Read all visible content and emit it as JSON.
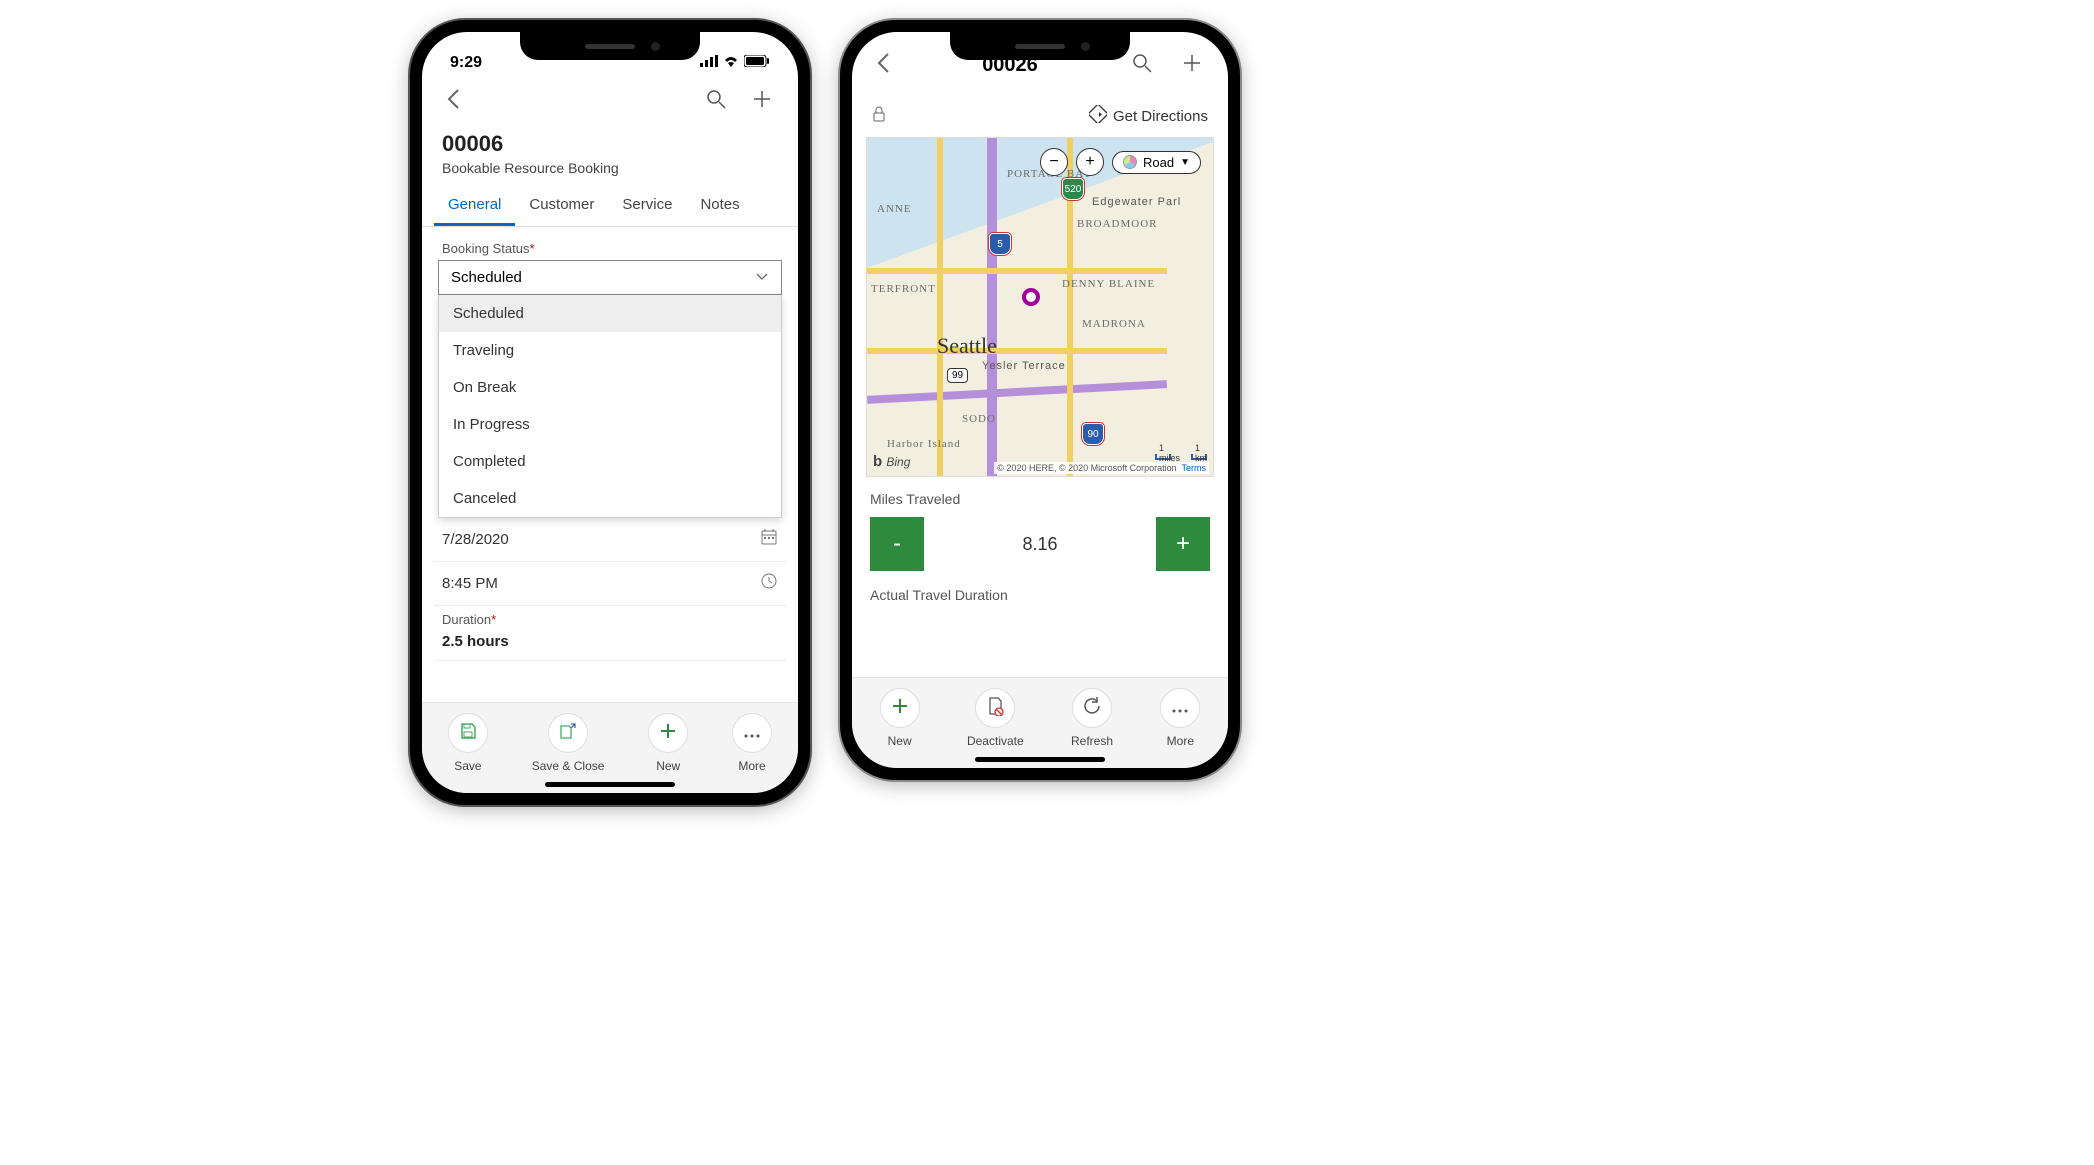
{
  "phone1": {
    "status_time": "9:29",
    "record_title": "00006",
    "record_subtitle": "Bookable Resource Booking",
    "tabs": [
      "General",
      "Customer",
      "Service",
      "Notes"
    ],
    "active_tab": "General",
    "booking_status_label": "Booking Status",
    "booking_status_value": "Scheduled",
    "status_options": [
      "Scheduled",
      "Traveling",
      "On Break",
      "In Progress",
      "Completed",
      "Canceled"
    ],
    "date_value": "7/28/2020",
    "time_value": "8:45 PM",
    "duration_label": "Duration",
    "duration_value": "2.5 hours",
    "actions": {
      "save": "Save",
      "save_close": "Save & Close",
      "new": "New",
      "more": "More"
    }
  },
  "phone2": {
    "record_title": "00026",
    "get_directions_label": "Get Directions",
    "map": {
      "view_mode": "Road",
      "city": "Seattle",
      "neighborhoods": [
        "PORTAGE BAY",
        "BROADMOOR",
        "DENNY BLAINE",
        "MADRONA",
        "Yesler Terrace",
        "SODO",
        "Harbor Island",
        "Edgewater Parl",
        "ANNE",
        "TERFRONT"
      ],
      "highways": [
        "5",
        "520",
        "90"
      ],
      "routes": [
        "99"
      ],
      "scale_miles": "1 miles",
      "scale_km": "1 km",
      "attribution": "© 2020 HERE, © 2020 Microsoft Corporation",
      "terms": "Terms",
      "provider": "Bing"
    },
    "miles_label": "Miles Traveled",
    "miles_value": "8.16",
    "actual_travel_label": "Actual Travel Duration",
    "actions": {
      "new": "New",
      "deactivate": "Deactivate",
      "refresh": "Refresh",
      "more": "More"
    }
  }
}
